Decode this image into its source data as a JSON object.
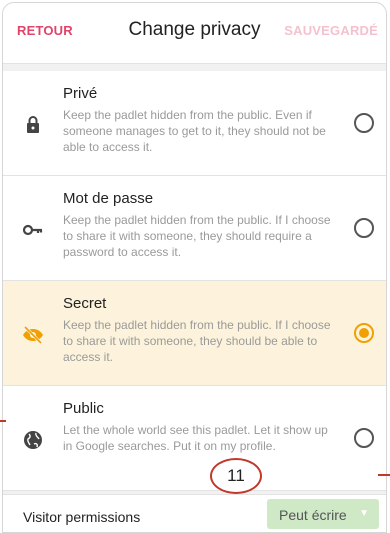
{
  "header": {
    "back_label": "RETOUR",
    "title": "Change privacy",
    "save_label": "SAUVEGARDÉ"
  },
  "options": [
    {
      "label": "Privé",
      "description": "Keep the padlet hidden from the public. Even if someone manages to get to it, they should not be able to access it.",
      "icon": "lock-icon",
      "selected": false
    },
    {
      "label": "Mot de passe",
      "description": "Keep the padlet hidden from the public. If I choose to share it with someone, they should require a password to access it.",
      "icon": "key-icon",
      "selected": false
    },
    {
      "label": "Secret",
      "description": "Keep the padlet hidden from the public. If I choose to share it with someone, they should be able to access it.",
      "icon": "eye-off-icon",
      "selected": true
    },
    {
      "label": "Public",
      "description": "Let the whole world see this padlet. Let it show up in Google searches. Put it on my profile.",
      "icon": "globe-icon",
      "selected": false
    }
  ],
  "permissions": {
    "label": "Visitor permissions",
    "value": "Peut écrire"
  },
  "annotation": {
    "number": "11"
  },
  "colors": {
    "accent": "#e0446b",
    "selected_bg": "#fdf3dc",
    "selected_radio": "#f0a000",
    "dropdown_bg": "#cfe8c6",
    "annotation": "#c0392b"
  }
}
